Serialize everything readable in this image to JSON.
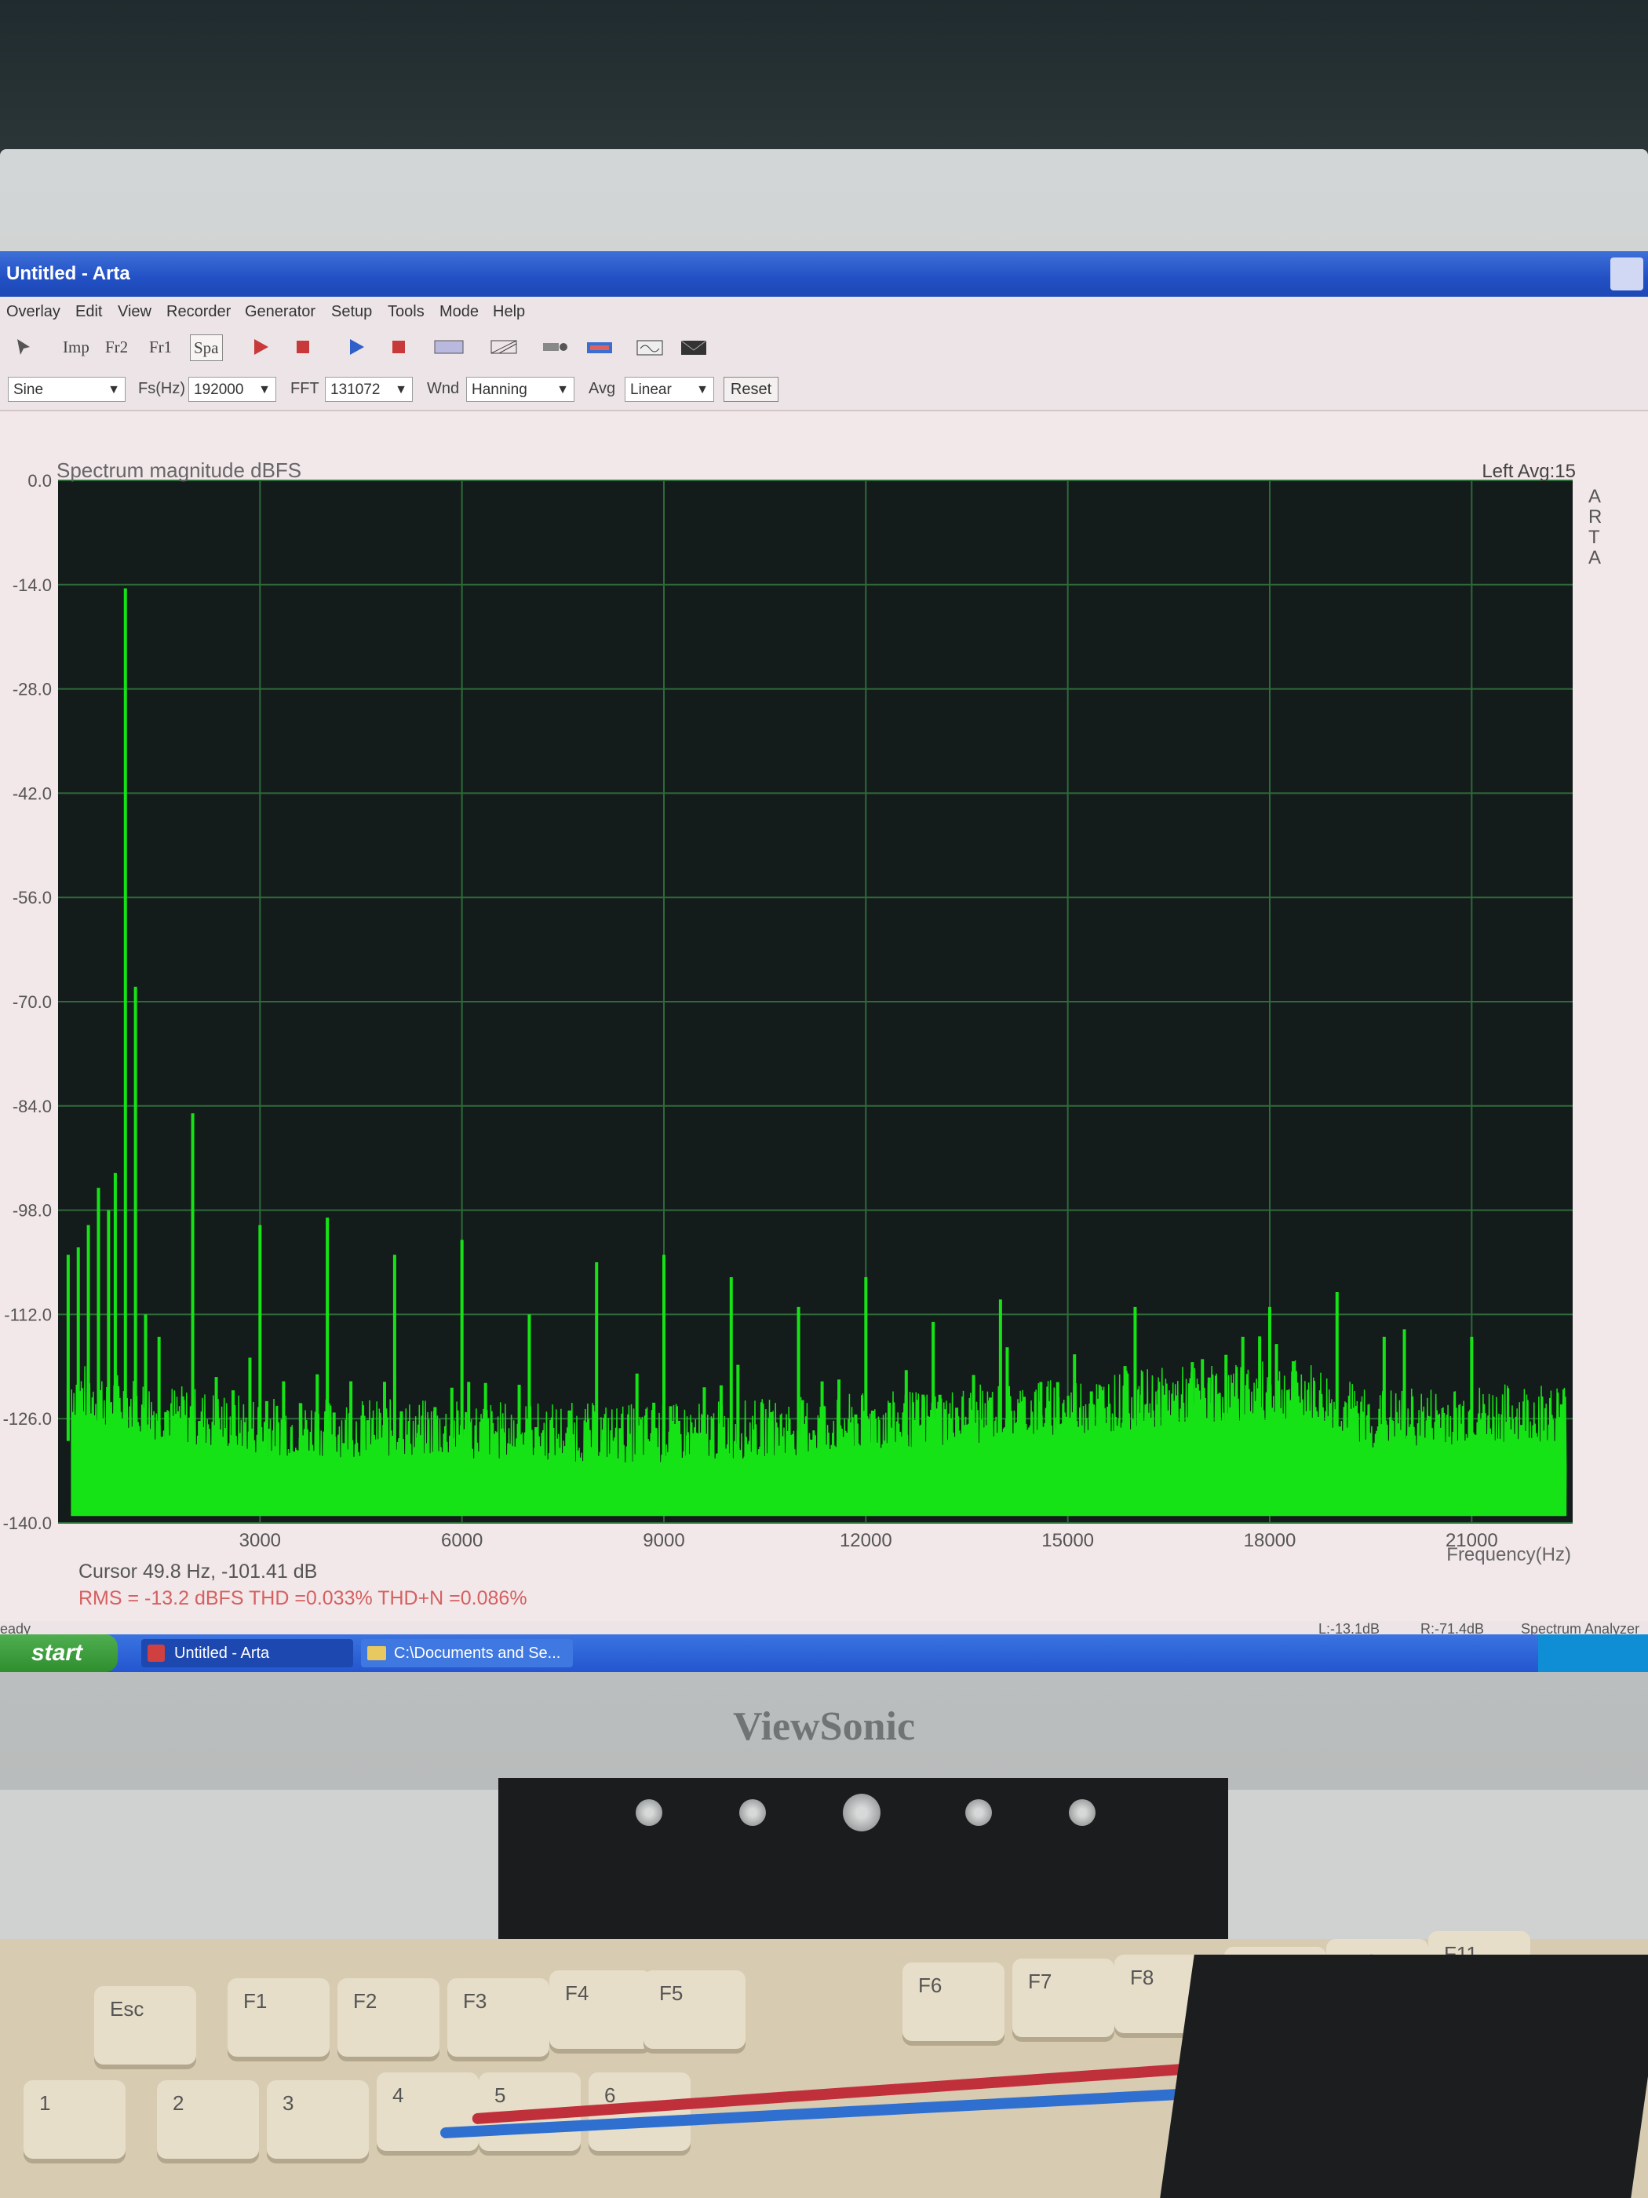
{
  "window": {
    "title": "Untitled - Arta",
    "menu": [
      "Overlay",
      "Edit",
      "View",
      "Recorder",
      "Generator",
      "Setup",
      "Tools",
      "Mode",
      "Help"
    ],
    "toolbar": [
      "Imp",
      "Fr2",
      "Fr1",
      "Spa"
    ]
  },
  "controls": {
    "signal": "Sine",
    "fs_label": "Fs(Hz)",
    "fs_value": "192000",
    "fft_label": "FFT",
    "fft_value": "131072",
    "wnd_label": "Wnd",
    "wnd_value": "Hanning",
    "avg_label": "Avg",
    "avg_value": "Linear",
    "reset_label": "Reset"
  },
  "chart_data": {
    "type": "line",
    "title": "Spectrum magnitude dBFS",
    "info_right": "Left  Avg:15",
    "side_label": "ARTA",
    "xlabel": "Frequency(Hz)",
    "ylabel": "",
    "xlim": [
      0,
      22500
    ],
    "ylim": [
      -140,
      0
    ],
    "x_ticks": [
      3000,
      6000,
      9000,
      12000,
      15000,
      18000,
      21000
    ],
    "y_ticks": [
      "0.0",
      "-14.0",
      "-28.0",
      "-42.0",
      "-56.0",
      "-70.0",
      "-84.0",
      "-98.0",
      "-112.0",
      "-126.0",
      "-140.0"
    ],
    "grid": true,
    "background": "#141b1b",
    "grid_color": "#2e6a3a",
    "trace_color": "#16e316",
    "peaks": [
      {
        "x": 1000,
        "y": -14.5
      },
      {
        "x": 1150,
        "y": -68
      },
      {
        "x": 2000,
        "y": -85
      },
      {
        "x": 3000,
        "y": -100
      },
      {
        "x": 4000,
        "y": -99
      },
      {
        "x": 5000,
        "y": -104
      },
      {
        "x": 6000,
        "y": -102
      },
      {
        "x": 7000,
        "y": -112
      },
      {
        "x": 8000,
        "y": -105
      },
      {
        "x": 9000,
        "y": -104
      },
      {
        "x": 10000,
        "y": -107
      },
      {
        "x": 11000,
        "y": -111
      },
      {
        "x": 12000,
        "y": -107
      },
      {
        "x": 13000,
        "y": -113
      },
      {
        "x": 14000,
        "y": -110
      },
      {
        "x": 16000,
        "y": -111
      },
      {
        "x": 17000,
        "y": -118
      },
      {
        "x": 18000,
        "y": -111
      },
      {
        "x": 19000,
        "y": -109
      },
      {
        "x": 19700,
        "y": -115
      },
      {
        "x": 20000,
        "y": -114
      },
      {
        "x": 21000,
        "y": -115
      }
    ],
    "noise_floor": [
      {
        "x": 200,
        "y": -126
      },
      {
        "x": 1500,
        "y": -129
      },
      {
        "x": 3000,
        "y": -131
      },
      {
        "x": 9000,
        "y": -132
      },
      {
        "x": 13000,
        "y": -130
      },
      {
        "x": 16500,
        "y": -127
      },
      {
        "x": 18500,
        "y": -126
      },
      {
        "x": 19500,
        "y": -130
      },
      {
        "x": 22400,
        "y": -129
      }
    ],
    "low_freq_cluster": [
      {
        "x": 150,
        "y": -104
      },
      {
        "x": 300,
        "y": -103
      },
      {
        "x": 450,
        "y": -100
      },
      {
        "x": 600,
        "y": -95
      },
      {
        "x": 750,
        "y": -98
      },
      {
        "x": 850,
        "y": -93
      },
      {
        "x": 1300,
        "y": -112
      },
      {
        "x": 1500,
        "y": -115
      }
    ],
    "cursor_text": "Cursor   49.8 Hz, -101.41 dB",
    "stats_text": "RMS = -13.2 dBFS   THD =0.033%   THD+N =0.086%"
  },
  "status": {
    "left": "eady",
    "levels_left": "L:-13.1dB",
    "levels_right": "R:-71.4dB",
    "mode": "Spectrum Analyzer"
  },
  "taskbar": {
    "start": "start",
    "items": [
      "Untitled - Arta",
      "C:\\Documents and Se..."
    ]
  },
  "monitor": {
    "brand": "ViewSonic"
  }
}
